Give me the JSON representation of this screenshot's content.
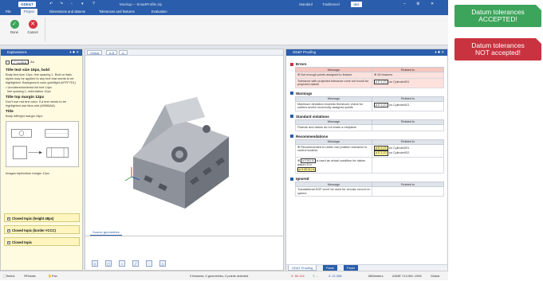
{
  "titlebar": {
    "logo": "GDE&T",
    "title": "Mockup -- SmartProfile.zip",
    "modes": [
      "Standard",
      "Traditionnel"
    ],
    "standard_badge": "ISO"
  },
  "ribbon_tabs": [
    "File",
    "Project",
    "Dimensions and datums",
    "Tolerances and features",
    "Evaluation"
  ],
  "ribbon": {
    "done": "Done",
    "cancel": "Cancel"
  },
  "explanations": {
    "header": "Explanations",
    "fcf_value": "0.25",
    "fcf_label": "A4",
    "title1": "Title text size 15px, bold",
    "body1": "Body text size 14px, line spacing 1. Bold or italic styles may be applied to any text that needs to be highlighted. Background color gold/light (#FFF7D1)",
    "bullets": [
      "Unordered/ordered list text 14px",
      "line spacing 1, indentation 12px"
    ],
    "title2": "Title top margin 12px",
    "body2": "Don't use red text color. If a text needs to be highlighted use blue-mid (#0066AA)",
    "title3": "Title",
    "body3": "Body left/right margin 15px.",
    "images_note": "Images top/bottom margin 12px.",
    "topics": [
      "Closed topic (height 48px)",
      "Closed topic (border #CCC)",
      "Closed topic"
    ]
  },
  "viewport": {
    "tabs": [
      "Global"
    ],
    "source_tab": "Source geometries"
  },
  "proofing": {
    "header": "GD&T Proofing",
    "col_message": "Message",
    "col_related": "Related to",
    "errors": {
      "title": "Errors",
      "rows": [
        {
          "message": "Not enough points assigned to feature",
          "related": "28 features"
        },
        {
          "message": "Tolerance with projected tolerance zone not found for projected datum",
          "fcf": "⌀ 0.1",
          "datum": "D",
          "related": "on Cylinder001"
        }
      ]
    },
    "warnings": {
      "title": "Warnings",
      "rows": [
        {
          "message": "Maximum deviation exceeds threshold: check for outliers and/or incorrectly assigned points",
          "fcf": "⌀ 0.1",
          "datum": "D",
          "related": "on Cylinder001"
        }
      ]
    },
    "standard": {
      "title": "Standard violations",
      "rows": [
        {
          "message": "Feature and datum do not share a midplane",
          "related": ""
        }
      ]
    },
    "recommendations": {
      "title": "Recommendations",
      "rows": [
        {
          "message": "Recommended to rather use position tolerance to control location",
          "fcf": "⌀ 0.1",
          "datum": "D",
          "related": "on Cylinder001",
          "fcf_b": "⌀ 0.1",
          "datum_b": "D",
          "related_b": "on Cylinder002"
        },
        {
          "message": "is used as virtual condition for datum datum D in",
          "fcf": "⌀ 0 M",
          "datum": "A",
          "fcf_b": "⌀ 0.05 M",
          "datum_b": "A"
        }
      ]
    },
    "ignored": {
      "title": "Ignored",
      "rows": [
        {
          "message": "Translational DOF won't be used for circular runout on sphere",
          "related": ""
        }
      ]
    },
    "bottom_tabs": [
      "GD&T Proofing",
      "Panel",
      "Panel"
    ]
  },
  "statusbar": {
    "select": "Select",
    "rotate": "Rotate",
    "pan": "Pan",
    "info": "0 features; 0 geometries, 0 points selected",
    "x": "X: 59.124",
    "y": "Y: --",
    "z": "Z: 21.058",
    "units": "Millimeters",
    "std": "ASME Y14.5M--1994",
    "global": "Global"
  },
  "banners": {
    "accepted": [
      "Datum tolerances",
      "ACCEPTED!"
    ],
    "rejected": [
      "Datum tolerances",
      "NOT accepted!"
    ]
  },
  "colors": {
    "accent": "#2a5dab",
    "accepted": "#3da45b",
    "rejected": "#c8333f",
    "explain_bg": "#fffbe0"
  }
}
